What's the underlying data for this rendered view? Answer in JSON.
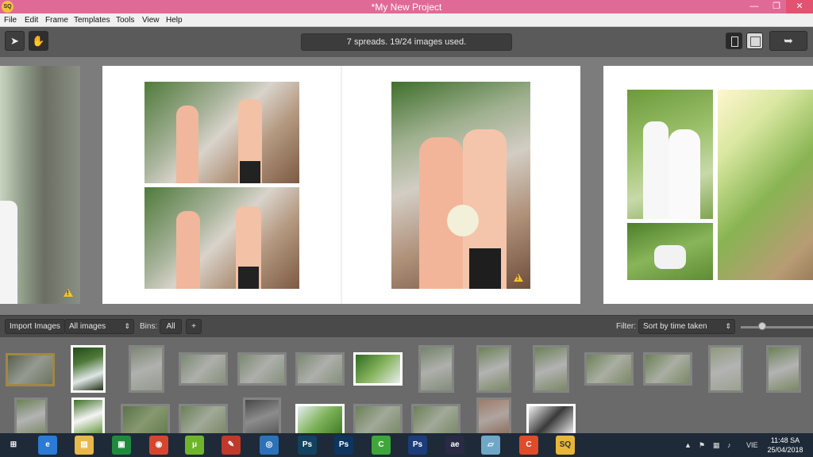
{
  "window": {
    "title": "*My New Project",
    "app_icon": "SQ",
    "minimize_icon": "minimize-icon",
    "maximize_icon": "maximize-icon",
    "close_icon": "close-icon"
  },
  "menu": [
    "File",
    "Edit",
    "Frame",
    "Templates",
    "Tools",
    "View",
    "Help"
  ],
  "toolbar": {
    "status": "7 spreads. 19/24 images used.",
    "select_tool_icon": "pointer-icon",
    "pan_tool_icon": "hand-icon",
    "single_view_icon": "single-page-view-icon",
    "double_view_icon": "spread-view-icon",
    "export_icon": "export-icon"
  },
  "binbar": {
    "import_label": "Import Images",
    "source_value": "All images",
    "bins_label": "Bins:",
    "bins_value": "All",
    "add_bin_label": "+",
    "filter_label": "Filter:",
    "sort_value": "Sort by time taken"
  },
  "taskbar": {
    "lang": "VIE",
    "time": "11:48 SA",
    "date": "25/04/2018",
    "apps": [
      {
        "name": "windows-start-icon",
        "label": "⊞",
        "color": "#1e2a38"
      },
      {
        "name": "internet-explorer-icon",
        "label": "e",
        "color": "#2a7ad6"
      },
      {
        "name": "file-explorer-icon",
        "label": "▤",
        "color": "#e8b84a"
      },
      {
        "name": "store-icon",
        "label": "▣",
        "color": "#1f8a3c"
      },
      {
        "name": "chrome-icon",
        "label": "◉",
        "color": "#d8452f"
      },
      {
        "name": "utorrent-icon",
        "label": "μ",
        "color": "#6fb52c"
      },
      {
        "name": "paint-icon",
        "label": "✎",
        "color": "#c0392b"
      },
      {
        "name": "media-icon",
        "label": "◎",
        "color": "#2d72b8"
      },
      {
        "name": "photoshop-icon",
        "label": "Ps",
        "color": "#12425e"
      },
      {
        "name": "photoshop-2-icon",
        "label": "Ps",
        "color": "#0c3560"
      },
      {
        "name": "camtasia-icon",
        "label": "C",
        "color": "#3ea63a"
      },
      {
        "name": "photoshop-3-icon",
        "label": "Ps",
        "color": "#1b3d7a"
      },
      {
        "name": "after-effects-icon",
        "label": "ae",
        "color": "#2a2a44"
      },
      {
        "name": "notes-icon",
        "label": "▱",
        "color": "#6fa8c7"
      },
      {
        "name": "camtasia-recorder-icon",
        "label": "C",
        "color": "#e04b2a"
      },
      {
        "name": "smart-albums-icon",
        "label": "SQ",
        "color": "#e8b63a"
      }
    ]
  },
  "colors": {
    "title_bar": "#e06a96",
    "selected_thumb": "#c9a22a",
    "warning": "#f1c232"
  }
}
